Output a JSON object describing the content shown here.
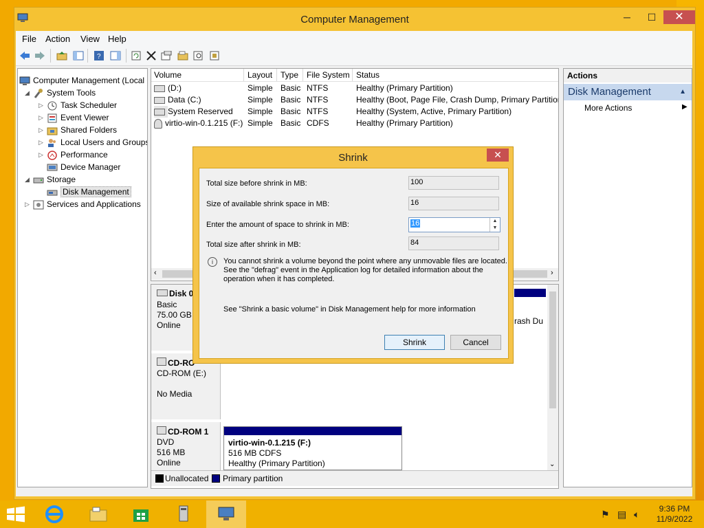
{
  "window": {
    "title": "Computer Management",
    "min": "─",
    "max": "☐",
    "close": "✕"
  },
  "menu": [
    "File",
    "Action",
    "View",
    "Help"
  ],
  "tree": {
    "root": "Computer Management (Local",
    "system_tools": "System Tools",
    "task_scheduler": "Task Scheduler",
    "event_viewer": "Event Viewer",
    "shared_folders": "Shared Folders",
    "local_users": "Local Users and Groups",
    "performance": "Performance",
    "device_manager": "Device Manager",
    "storage": "Storage",
    "disk_management": "Disk Management",
    "services": "Services and Applications"
  },
  "list": {
    "columns": [
      "Volume",
      "Layout",
      "Type",
      "File System",
      "Status"
    ],
    "rows": [
      {
        "volume": "(D:)",
        "layout": "Simple",
        "type": "Basic",
        "fs": "NTFS",
        "status": "Healthy (Primary Partition)"
      },
      {
        "volume": "Data (C:)",
        "layout": "Simple",
        "type": "Basic",
        "fs": "NTFS",
        "status": "Healthy (Boot, Page File, Crash Dump, Primary Partition"
      },
      {
        "volume": "System Reserved",
        "layout": "Simple",
        "type": "Basic",
        "fs": "NTFS",
        "status": "Healthy (System, Active, Primary Partition)"
      },
      {
        "volume": "virtio-win-0.1.215 (F:)",
        "layout": "Simple",
        "type": "Basic",
        "fs": "CDFS",
        "status": "Healthy (Primary Partition)"
      }
    ]
  },
  "disks": {
    "disk0": {
      "name": "Disk 0",
      "type": "Basic",
      "size": "75.00 GB",
      "state": "Online",
      "clip": "rash Du"
    },
    "cdrom0": {
      "name": "CD-RO",
      "line2": "CD-ROM (E:)",
      "line3": "No Media"
    },
    "cdrom1": {
      "name": "CD-ROM 1",
      "type": "DVD",
      "size": "516 MB",
      "state": "Online",
      "volume": "virtio-win-0.1.215  (F:)",
      "vsize": "516 MB CDFS",
      "vstatus": "Healthy (Primary Partition)"
    },
    "legend_unalloc": "Unallocated",
    "legend_primary": "Primary partition"
  },
  "actions": {
    "header": "Actions",
    "section": "Disk Management",
    "more": "More Actions"
  },
  "dialog": {
    "title": "Shrink",
    "close": "✕",
    "total_before_label": "Total size before shrink in MB:",
    "total_before": "100",
    "available_label": "Size of available shrink space in MB:",
    "available": "16",
    "enter_label": "Enter the amount of space to shrink in MB:",
    "enter_value": "16",
    "after_label": "Total size after shrink in MB:",
    "after": "84",
    "info1": "You cannot shrink a volume beyond the point where any unmovable files are located.",
    "info2": "See the \"defrag\" event in the Application log for detailed information about the",
    "info3": "operation when it has completed.",
    "help": "See \"Shrink a basic volume\" in Disk Management help for more information",
    "shrink_btn": "Shrink",
    "cancel_btn": "Cancel"
  },
  "clock": {
    "time": "9:36 PM",
    "date": "11/9/2022"
  },
  "colors": {
    "primary_partition": "#00007f",
    "unallocated": "#000000"
  }
}
